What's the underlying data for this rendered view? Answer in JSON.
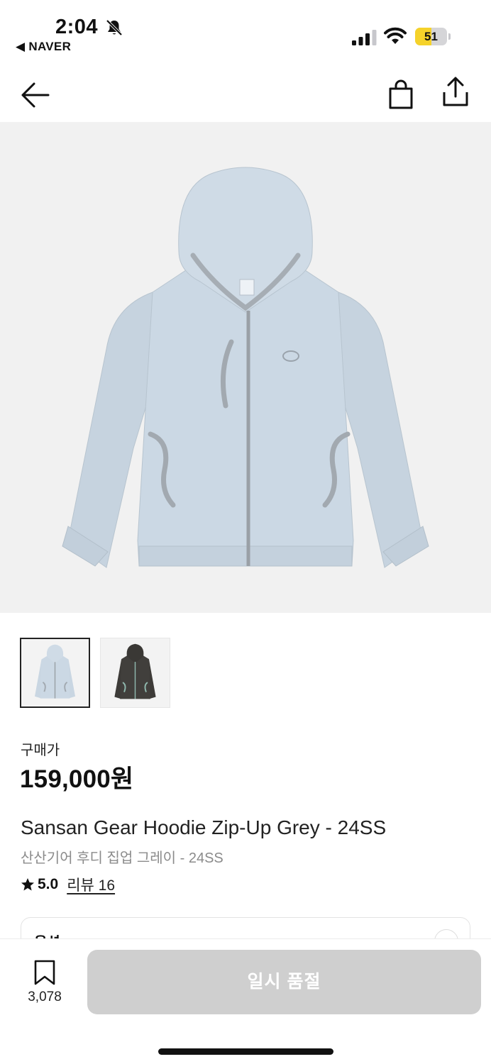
{
  "status_bar": {
    "time": "2:04",
    "back_app": "◀ NAVER",
    "battery_level": "51"
  },
  "header": {
    "back_icon": "arrow-left-icon",
    "bag_icon": "shopping-bag-icon",
    "share_icon": "share-icon"
  },
  "product": {
    "image_alt_icon": "hoodie-image",
    "thumbnails": [
      {
        "color": "#c9d6e2",
        "selected": true
      },
      {
        "color": "#3d3b38",
        "selected": false
      }
    ],
    "price_label": "구매가",
    "price": "159,000원",
    "name_en": "Sansan Gear Hoodie Zip-Up Grey - 24SS",
    "name_ko": "산산기어 후디 집업 그레이 - 24SS",
    "rating": "5.0",
    "review_link": "리뷰 16",
    "option_label": "옵션"
  },
  "bottom_bar": {
    "wish_count": "3,078",
    "soldout_label": "일시 품절"
  },
  "colors": {
    "hoodie_light": "#c9d6e2",
    "hoodie_trim": "#9ea4aa",
    "hoodie_dark": "#3d3b38",
    "hoodie_dark_trim": "#8fb8ad",
    "battery": "#f5d22a",
    "button_disabled": "#cfcfcf"
  }
}
